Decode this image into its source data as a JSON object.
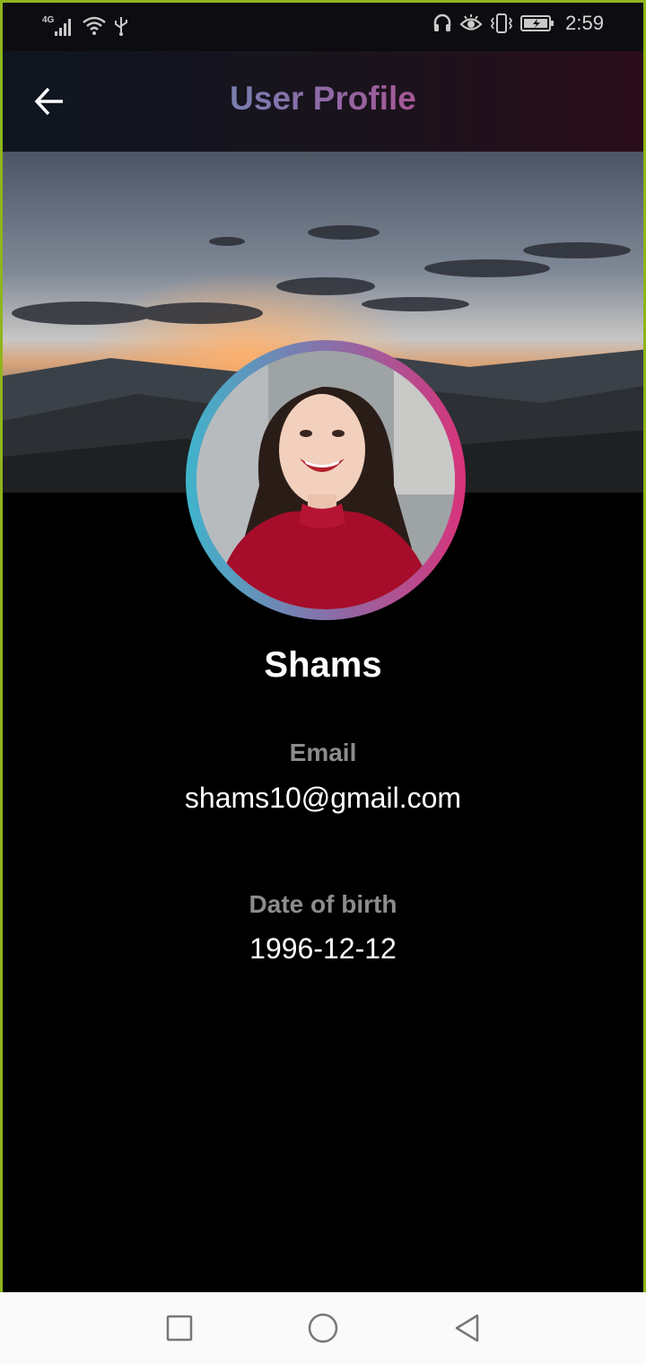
{
  "status_bar": {
    "network": "4G",
    "time": "2:59",
    "icons": [
      "signal-icon",
      "wifi-icon",
      "usb-icon",
      "headphones-icon",
      "eye-icon",
      "vibrate-icon",
      "battery-charging-icon"
    ]
  },
  "app_bar": {
    "title": "User Profile",
    "back_icon": "arrow-left-icon",
    "title_gradient": [
      "#3fb4cc",
      "#8e6aa6",
      "#e0286b"
    ]
  },
  "profile": {
    "name": "Shams",
    "fields": [
      {
        "label": "Email",
        "value": "shams10@gmail.com"
      },
      {
        "label": "Date of birth",
        "value": "1996-12-12"
      }
    ]
  },
  "nav_bar": {
    "buttons": [
      "recents-square-icon",
      "home-circle-icon",
      "back-triangle-icon"
    ]
  },
  "colors": {
    "background": "#000000",
    "label": "#8c8c8c",
    "value": "#ffffff",
    "avatar_ring": [
      "#3fb4cc",
      "#8e6aa6",
      "#d8337a"
    ]
  }
}
